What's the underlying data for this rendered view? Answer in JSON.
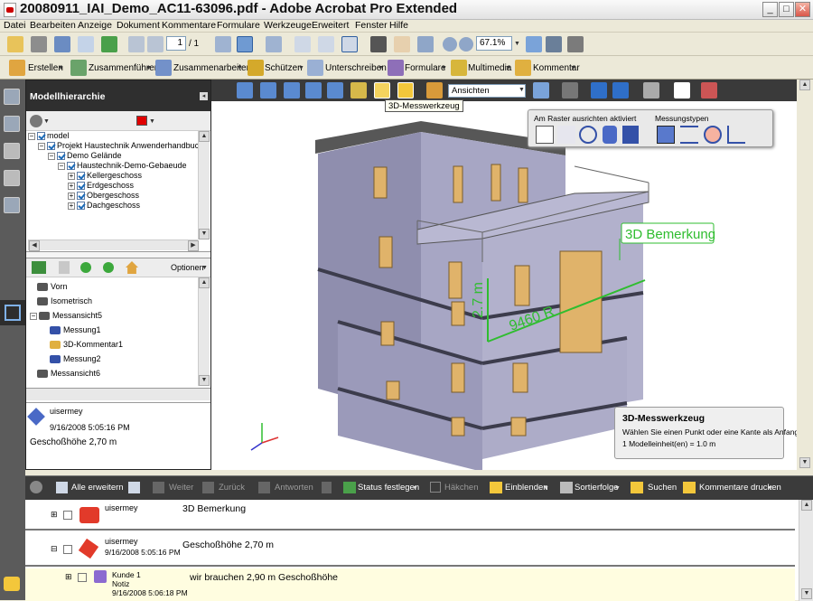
{
  "window": {
    "title": "20080911_IAI_Demo_AC11-63096.pdf - Adobe Acrobat Pro Extended",
    "minimize": "_",
    "maximize": "□",
    "close": "✕"
  },
  "menu": [
    "Datei",
    "Bearbeiten",
    "Anzeige",
    "Dokument",
    "Kommentare",
    "Formulare",
    "Werkzeuge",
    "Erweitert",
    "Fenster",
    "Hilfe"
  ],
  "toolbar1": {
    "page_current": "1",
    "page_total": "/ 1",
    "zoom": "67.1%"
  },
  "toolbar2": {
    "items": [
      "Erstellen",
      "Zusammenführen",
      "Zusammenarbeiten",
      "Schützen",
      "Unterschreiben",
      "Formulare",
      "Multimedia",
      "Kommentar"
    ]
  },
  "panel": {
    "title": "Modellhierarchie",
    "color": "#e00000",
    "tree": [
      {
        "label": "model",
        "level": 0
      },
      {
        "label": "Projekt Haustechnik Anwenderhandbuch",
        "level": 1
      },
      {
        "label": "Demo Gelände",
        "level": 2
      },
      {
        "label": "Haustechnik-Demo-Gebaeude",
        "level": 3
      },
      {
        "label": "Kellergeschoss",
        "level": 4
      },
      {
        "label": "Erdgeschoss",
        "level": 4
      },
      {
        "label": "Obergeschoss",
        "level": 4
      },
      {
        "label": "Dachgeschoss",
        "level": 4
      }
    ],
    "options_label": "Optionen",
    "views": [
      {
        "label": "Vorn",
        "indent": 0,
        "type": "camera"
      },
      {
        "label": "Isometrisch",
        "indent": 0,
        "type": "camera"
      },
      {
        "label": "Messansicht5",
        "indent": 0,
        "type": "camera"
      },
      {
        "label": "Messung1",
        "indent": 1,
        "type": "measure"
      },
      {
        "label": "3D-Kommentar1",
        "indent": 1,
        "type": "note"
      },
      {
        "label": "Messung2",
        "indent": 1,
        "type": "measure"
      },
      {
        "label": "Messansicht6",
        "indent": 0,
        "type": "camera"
      }
    ],
    "comment": {
      "author": "uisermey",
      "date": "9/16/2008 5:05:16 PM",
      "text": "Geschoßhöhe 2,70 m"
    }
  },
  "viewer": {
    "views_select": "Ansichten",
    "tooltip": "3D-Messwerkzeug",
    "measure_panel": {
      "snap_label": "Am Raster ausrichten aktiviert",
      "types_label": "Messungstypen"
    },
    "annotation_label": "3D Bemerkung",
    "dim_horizontal": "9460 R",
    "dim_vertical": "2.7 m",
    "hint": {
      "title": "3D-Messwerkzeug",
      "line1": "Wählen Sie einen Punkt oder eine Kante als Anfang.",
      "line2": "1 Modelleinheit(en) = 1.0 m"
    },
    "colors": {
      "wall": "#a7a6c4",
      "wall_dark": "#8f8eae",
      "roof": "#575757",
      "window_frame": "#e0b36a",
      "measure": "#2fbd2f"
    }
  },
  "comments_toolbar": {
    "items": [
      {
        "label": "Alle erweitern",
        "enabled": true
      },
      {
        "label": "Weiter",
        "enabled": false
      },
      {
        "label": "Zurück",
        "enabled": false
      },
      {
        "label": "Antworten",
        "enabled": false
      },
      {
        "label": "Status festlegen",
        "enabled": true
      },
      {
        "label": "Häkchen",
        "enabled": false
      },
      {
        "label": "Einblenden",
        "enabled": true
      },
      {
        "label": "Sortierfolge",
        "enabled": true
      },
      {
        "label": "Suchen",
        "enabled": true
      },
      {
        "label": "Kommentare drucken",
        "enabled": true
      }
    ]
  },
  "comments": [
    {
      "author": "uisermey",
      "date": "",
      "text": "3D Bemerkung",
      "kind": "note3d"
    },
    {
      "author": "uisermey",
      "date": "9/16/2008 5:05:16 PM",
      "text": "Geschoßhöhe 2,70 m",
      "kind": "measure"
    },
    {
      "author": "Kunde 1",
      "subtype": "Notiz",
      "date": "9/16/2008 5:06:18 PM",
      "text": "wir brauchen 2,90 m Geschoßhöhe",
      "kind": "reply"
    }
  ]
}
